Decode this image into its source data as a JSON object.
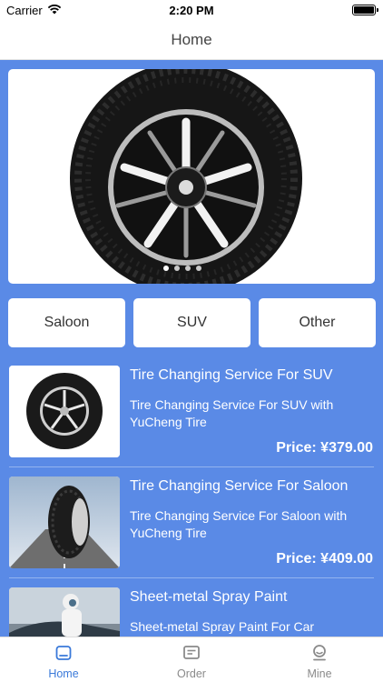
{
  "status_bar": {
    "carrier": "Carrier",
    "time": "2:20 PM"
  },
  "nav": {
    "title": "Home"
  },
  "banner": {
    "page_count": 4,
    "current_page": 1
  },
  "categories": [
    {
      "label": "Saloon"
    },
    {
      "label": "SUV"
    },
    {
      "label": "Other"
    }
  ],
  "products": [
    {
      "name": "Tire Changing Service For SUV",
      "description": "Tire Changing Service For SUV with YuCheng Tire",
      "price": "Price: ¥379.00",
      "image": "suv-tire-image"
    },
    {
      "name": "Tire Changing Service For Saloon",
      "description": "Tire Changing Service For Saloon with YuCheng Tire",
      "price": "Price: ¥409.00",
      "image": "saloon-tire-road-image"
    },
    {
      "name": "Sheet-metal Spray Paint",
      "description": "Sheet-metal Spray Paint For Car",
      "image": "spray-paint-worker-image"
    }
  ],
  "tabs": [
    {
      "label": "Home",
      "icon": "home-icon",
      "active": true
    },
    {
      "label": "Order",
      "icon": "order-icon",
      "active": false
    },
    {
      "label": "Mine",
      "icon": "mine-icon",
      "active": false
    }
  ],
  "colors": {
    "background": "#5a8ae6",
    "accent": "#3a79d9"
  }
}
